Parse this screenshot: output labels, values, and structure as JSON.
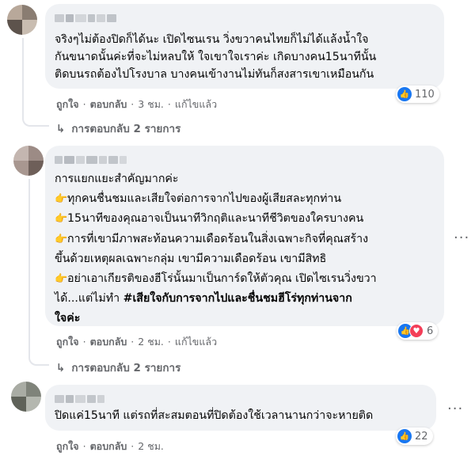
{
  "comments": [
    {
      "lines": [
        "จริงๆไม่ต้องปิดก็ได้นะ เปิดไซนเรน วิ่งขวาคนไทยก็ไม่ได้แล้งน้ำใจ",
        "กันขนาดนั้นค่ะที่จะไม่หลบให้ ใจเขาใจเราค่ะ เกิดบางคน15นาทีนั้น",
        "ติดบนรถต้องไปโรงบาล บางคนเข้างานไม่ทันก็สงสารเขาเหมือนกัน"
      ],
      "reaction_count": "110",
      "actions": {
        "like": "ถูกใจ",
        "reply": "ตอบกลับ",
        "time": "3 ชม.",
        "edited": "แก้ไขแล้ว"
      },
      "replies": "การตอบกลับ 2 รายการ"
    },
    {
      "intro": "การแยกแยะสำคัญมากค่ะ",
      "emoji": "👉",
      "bullets": [
        "ทุกคนชื่นชมและเสียใจต่อการจากไปของผู้เสียสละทุกท่าน",
        "15นาทีของคุณอาจเป็นนาทีวิกฤติและนาทีชีวิตของใครบางคน",
        "การที่เขามีภาพสะท้อนความเดือดร้อนในสิ่งเฉพาะกิจที่คุณสร้าง",
        "ขึ้นด้วยเหตุผลเฉพาะกลุ่ม เขามีความเดือดร้อน เขามีสิทธิ",
        "อย่าเอาเกียรติของฮีโร่นั้นมาเป็นการ์ดให้ตัวคุณ เปิดไซเรนวิ่งขวา",
        "ได้...แต่ไม่ทำ"
      ],
      "hashtag_line1": "#เสียใจกับการจากไปและชื่นชมฮีโร่ทุกท่านจาก",
      "hashtag_line2": "ใจค่ะ",
      "reaction_count": "6",
      "actions": {
        "like": "ถูกใจ",
        "reply": "ตอบกลับ",
        "time": "2 ชม.",
        "edited": "แก้ไขแล้ว"
      },
      "replies": "การตอบกลับ 2 รายการ"
    },
    {
      "lines": [
        "ปิดแค่15นาที แต่รถที่สะสมตอนที่ปิดต้องใช้เวลานานกว่าจะหายติด"
      ],
      "reaction_count": "22",
      "actions": {
        "like": "ถูกใจ",
        "reply": "ตอบกลับ",
        "time": "2 ชม."
      }
    }
  ],
  "more_icon": "more-horizontal-icon",
  "colors": {
    "bubble": "#f0f2f5",
    "like": "#1877f2",
    "love": "#f33e58",
    "meta": "#65676b"
  }
}
